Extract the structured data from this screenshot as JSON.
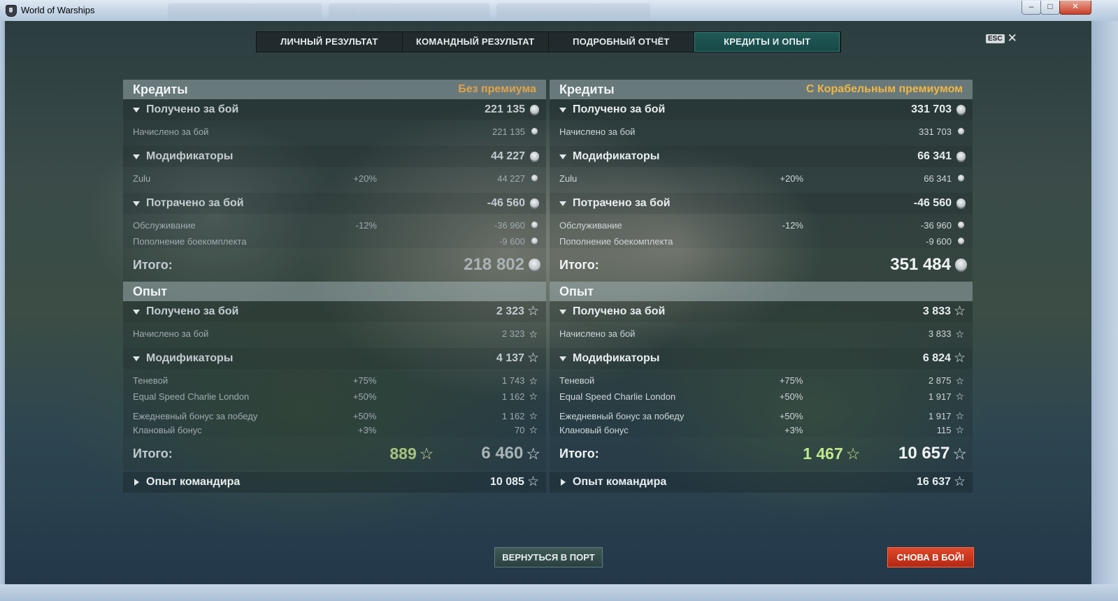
{
  "window": {
    "title": "World of Warships"
  },
  "tabs": [
    {
      "label": "ЛИЧНЫЙ РЕЗУЛЬТАТ"
    },
    {
      "label": "КОМАНДНЫЙ РЕЗУЛЬТАТ"
    },
    {
      "label": "ПОДРОБНЫЙ ОТЧЁТ"
    },
    {
      "label": "КРЕДИТЫ И ОПЫТ"
    }
  ],
  "active_tab": "КРЕДИТЫ И ОПЫТ",
  "esc_label": "ESC",
  "left": {
    "credits": {
      "title": "Кредиты",
      "premium_label": "Без премиума",
      "received": {
        "label": "Получено за бой",
        "value": "221 135"
      },
      "accrued": {
        "label": "Начислено за бой",
        "value": "221 135"
      },
      "modifiers": {
        "label": "Модификаторы",
        "value": "44 227"
      },
      "zulu": {
        "label": "Zulu",
        "pct": "+20%",
        "value": "44 227"
      },
      "spent": {
        "label": "Потрачено за бой",
        "value": "-46 560"
      },
      "service": {
        "label": "Обслуживание",
        "pct": "-12%",
        "value": "-36 960"
      },
      "ammo": {
        "label": "Пополнение боекомплекта",
        "value": "-9 600"
      },
      "total": {
        "label": "Итого:",
        "value": "218 802"
      }
    },
    "exp": {
      "title": "Опыт",
      "received": {
        "label": "Получено за бой",
        "value": "2 323"
      },
      "accrued": {
        "label": "Начислено за бой",
        "value": "2 323"
      },
      "modifiers": {
        "label": "Модификаторы",
        "value": "4 137"
      },
      "shadow": {
        "label": "Теневой",
        "pct": "+75%",
        "value": "1 743"
      },
      "escl": {
        "label": "Equal Speed Charlie London",
        "pct": "+50%",
        "value": "1 162"
      },
      "daily": {
        "label": "Ежедневный бонус за победу",
        "pct": "+50%",
        "value": "1 162"
      },
      "clan": {
        "label": "Клановый бонус",
        "pct": "+3%",
        "value": "70"
      },
      "total": {
        "label": "Итого:",
        "elite": "889",
        "value": "6 460"
      },
      "commander": {
        "label": "Опыт командира",
        "value": "10 085"
      }
    }
  },
  "right": {
    "credits": {
      "title": "Кредиты",
      "premium_label": "С Корабельным премиумом",
      "received": {
        "label": "Получено за бой",
        "value": "331 703"
      },
      "accrued": {
        "label": "Начислено за бой",
        "value": "331 703"
      },
      "modifiers": {
        "label": "Модификаторы",
        "value": "66 341"
      },
      "zulu": {
        "label": "Zulu",
        "pct": "+20%",
        "value": "66 341"
      },
      "spent": {
        "label": "Потрачено за бой",
        "value": "-46 560"
      },
      "service": {
        "label": "Обслуживание",
        "pct": "-12%",
        "value": "-36 960"
      },
      "ammo": {
        "label": "Пополнение боекомплекта",
        "value": "-9 600"
      },
      "total": {
        "label": "Итого:",
        "value": "351 484"
      }
    },
    "exp": {
      "title": "Опыт",
      "received": {
        "label": "Получено за бой",
        "value": "3 833"
      },
      "accrued": {
        "label": "Начислено за бой",
        "value": "3 833"
      },
      "modifiers": {
        "label": "Модификаторы",
        "value": "6 824"
      },
      "shadow": {
        "label": "Теневой",
        "pct": "+75%",
        "value": "2 875"
      },
      "escl": {
        "label": "Equal Speed Charlie London",
        "pct": "+50%",
        "value": "1 917"
      },
      "daily": {
        "label": "Ежедневный бонус за победу",
        "pct": "+50%",
        "value": "1 917"
      },
      "clan": {
        "label": "Клановый бонус",
        "pct": "+3%",
        "value": "115"
      },
      "total": {
        "label": "Итого:",
        "elite": "1 467",
        "value": "10 657"
      },
      "commander": {
        "label": "Опыт командира",
        "value": "16 637"
      }
    }
  },
  "buttons": {
    "port": "ВЕРНУТЬСЯ В ПОРТ",
    "battle": "СНОВА В БОЙ!"
  },
  "colors": {
    "active_tab": "#1d534f",
    "premium_none": "#e0a24a",
    "premium_ship": "#f0b646",
    "elite_exp": "#bfe98a",
    "battle_button": "#d03a1e"
  },
  "icons": {
    "credits": "credits-coin-icon",
    "exp": "star-icon"
  }
}
